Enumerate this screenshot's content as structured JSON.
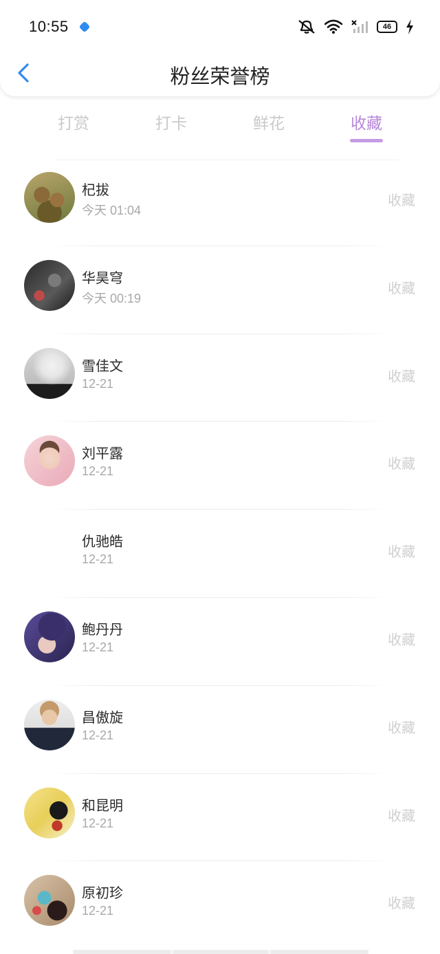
{
  "status_bar": {
    "time": "10:55",
    "battery_level": "46",
    "icons": [
      "app-dot-icon",
      "mute-icon",
      "wifi-icon",
      "no-signal-icon",
      "battery-icon",
      "charging-icon"
    ]
  },
  "header": {
    "title": "粉丝荣誉榜",
    "back_icon": "chevron-left-icon"
  },
  "tabs": [
    {
      "label": "打赏",
      "active": false
    },
    {
      "label": "打卡",
      "active": false
    },
    {
      "label": "鲜花",
      "active": false
    },
    {
      "label": "收藏",
      "active": true
    }
  ],
  "list": [
    {
      "name": "杞拔",
      "time": "今天 01:04",
      "action": "收藏"
    },
    {
      "name": "华昊穹",
      "time": "今天 00:19",
      "action": "收藏"
    },
    {
      "name": "雪佳文",
      "time": "12-21",
      "action": "收藏"
    },
    {
      "name": "刘平露",
      "time": "12-21",
      "action": "收藏"
    },
    {
      "name": "仇驰皓",
      "time": "12-21",
      "action": "收藏"
    },
    {
      "name": "鲍丹丹",
      "time": "12-21",
      "action": "收藏"
    },
    {
      "name": "昌傲旋",
      "time": "12-21",
      "action": "收藏"
    },
    {
      "name": "和昆明",
      "time": "12-21",
      "action": "收藏"
    },
    {
      "name": "原初珍",
      "time": "12-21",
      "action": "收藏"
    }
  ],
  "colors": {
    "accent": "#b787d8",
    "back_arrow": "#2f8bf0",
    "inactive_tab": "#c9c9c9"
  }
}
